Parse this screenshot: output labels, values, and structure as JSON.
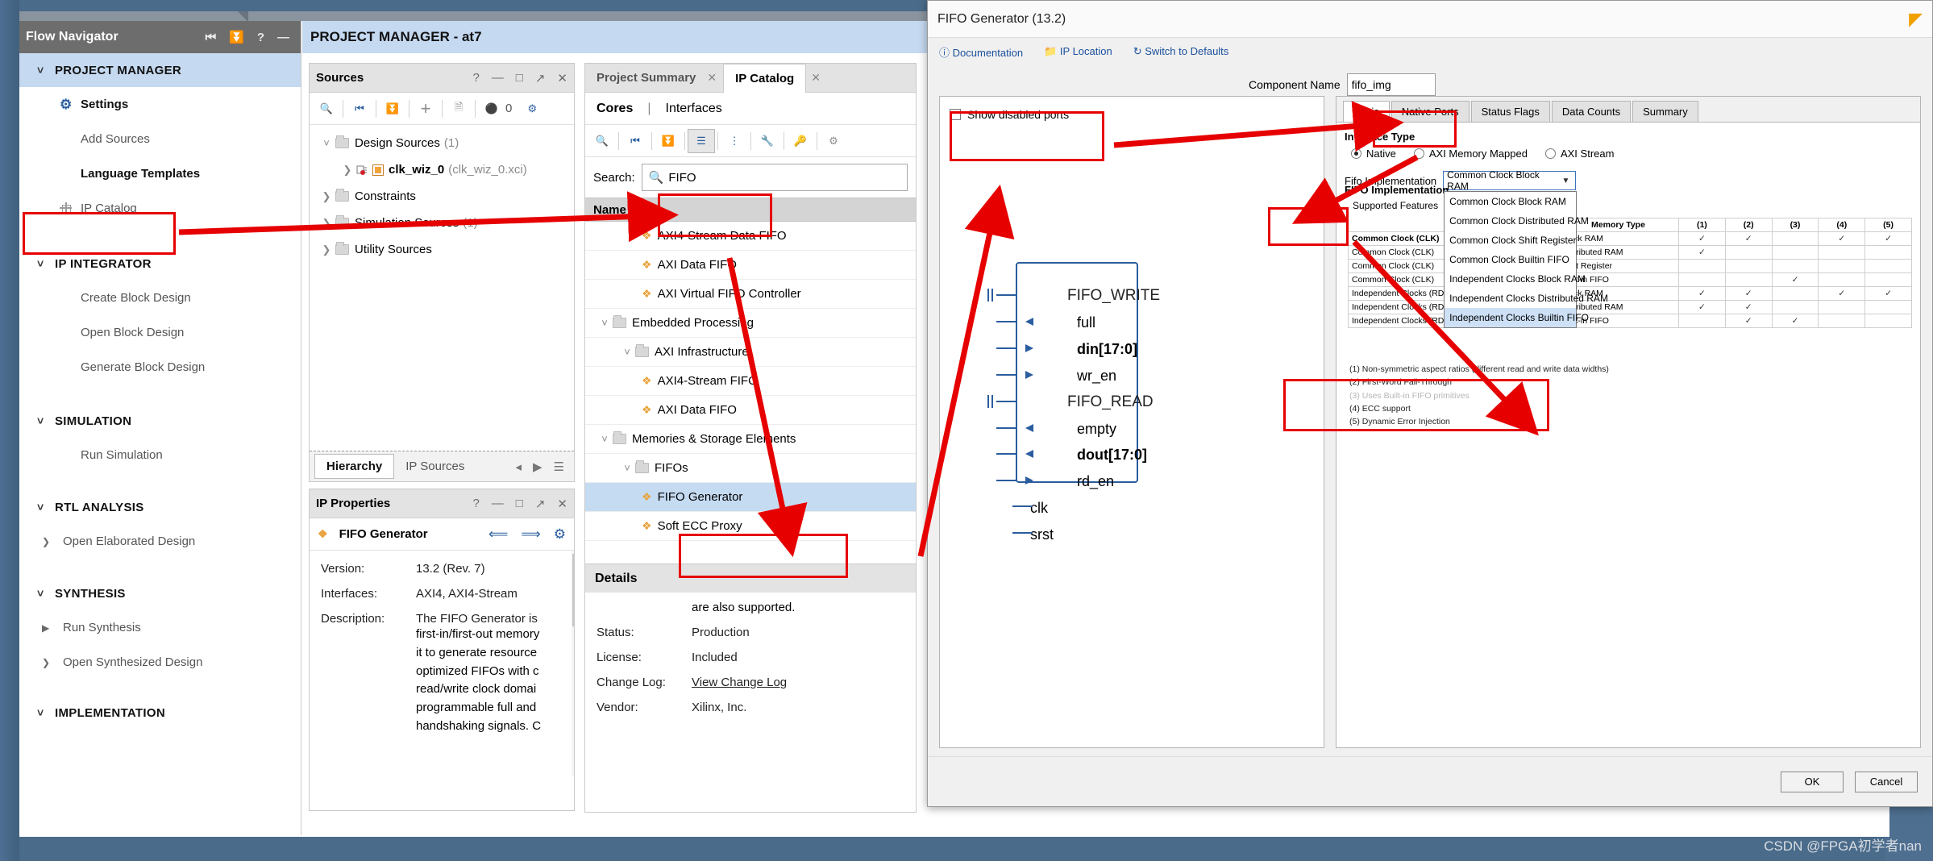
{
  "flow_navigator": {
    "title": "Flow Navigator",
    "header_icons": [
      "collapse-icon",
      "expand-icon",
      "help-icon",
      "minimize-icon"
    ],
    "sections": [
      {
        "label": "PROJECT MANAGER",
        "active": true,
        "items": [
          {
            "label": "Settings",
            "icon": "gear-icon",
            "bold": true
          },
          {
            "label": "Add Sources",
            "icon": "",
            "bold": false
          },
          {
            "label": "Language Templates",
            "icon": "",
            "bold": true
          },
          {
            "label": "IP Catalog",
            "icon": "ip-icon",
            "bold": false,
            "highlighted": true
          }
        ]
      },
      {
        "label": "IP INTEGRATOR",
        "active": false,
        "items": [
          {
            "label": "Create Block Design",
            "icon": "",
            "bold": false
          },
          {
            "label": "Open Block Design",
            "icon": "",
            "bold": false
          },
          {
            "label": "Generate Block Design",
            "icon": "",
            "bold": false
          }
        ]
      },
      {
        "label": "SIMULATION",
        "active": false,
        "items": [
          {
            "label": "Run Simulation",
            "icon": "",
            "bold": false
          }
        ]
      },
      {
        "label": "RTL ANALYSIS",
        "active": false,
        "items": [
          {
            "label": "Open Elaborated Design",
            "icon": "arrow-icon",
            "bold": false
          }
        ]
      },
      {
        "label": "SYNTHESIS",
        "active": false,
        "items": [
          {
            "label": "Run Synthesis",
            "icon": "play-icon",
            "bold": false
          },
          {
            "label": "Open Synthesized Design",
            "icon": "arrow-icon",
            "bold": false
          }
        ]
      },
      {
        "label": "IMPLEMENTATION",
        "active": false,
        "items": []
      }
    ]
  },
  "project_manager": {
    "title": "PROJECT MANAGER - at7"
  },
  "sources_panel": {
    "title": "Sources",
    "window_buttons": [
      "help-icon",
      "minimize-icon",
      "maximize-icon",
      "float-icon",
      "close-icon"
    ],
    "toolbar": [
      "search-icon",
      "collapse-all-icon",
      "expand-all-icon",
      "add-icon",
      "report-icon",
      "warning-icon",
      "gear-icon"
    ],
    "warning_count": "0",
    "tree": [
      {
        "label": "Design Sources",
        "count": "(1)",
        "expanded": true,
        "depth": 0,
        "icon": "folder-icon"
      },
      {
        "label": "clk_wiz_0",
        "sub": "(clk_wiz_0.xci)",
        "expanded": false,
        "depth": 1,
        "icon": "xci-icon"
      },
      {
        "label": "Constraints",
        "count": "",
        "expanded": false,
        "depth": 0,
        "icon": "folder-icon"
      },
      {
        "label": "Simulation Sources",
        "count": "(1)",
        "expanded": false,
        "depth": 0,
        "icon": "folder-icon"
      },
      {
        "label": "Utility Sources",
        "count": "",
        "expanded": false,
        "depth": 0,
        "icon": "folder-icon"
      }
    ],
    "tabs": [
      {
        "label": "Hierarchy",
        "selected": true
      },
      {
        "label": "IP Sources",
        "selected": false
      }
    ]
  },
  "ip_properties": {
    "title": "IP Properties",
    "ip_name": "FIFO Generator",
    "rows": [
      {
        "key": "Version:",
        "value": "13.2 (Rev. 7)",
        "link": false
      },
      {
        "key": "Interfaces:",
        "value": "AXI4, AXI4-Stream",
        "link": false
      },
      {
        "key": "Description:",
        "value": "The FIFO Generator is",
        "link": false
      }
    ],
    "description_lines": [
      "first-in/first-out memory",
      "it to generate resource",
      "optimized FIFOs with c",
      "read/write clock domai",
      "programmable full and",
      "handshaking signals. C"
    ]
  },
  "ip_catalog": {
    "tabs": [
      {
        "label": "Project Summary",
        "selected": false
      },
      {
        "label": "IP Catalog",
        "selected": true
      }
    ],
    "cores_tabs": [
      {
        "label": "Cores",
        "selected": true
      },
      {
        "label": "Interfaces",
        "selected": false
      }
    ],
    "toolbar": [
      "search-icon",
      "collapse-all-icon",
      "expand-all-icon",
      "group-icon",
      "tree-icon",
      "wrench-icon",
      "key-icon",
      "chip-icon"
    ],
    "search_label": "Search:",
    "search_value": "FIFO",
    "column_header": "Name",
    "items": [
      {
        "label": "AXI4-Stream Data FIFO",
        "depth": 2,
        "leaf": true,
        "expanded": false
      },
      {
        "label": "AXI Data FIFO",
        "depth": 2,
        "leaf": true,
        "expanded": false
      },
      {
        "label": "AXI Virtual FIFO Controller",
        "depth": 2,
        "leaf": true,
        "expanded": false
      },
      {
        "label": "Embedded Processing",
        "depth": 0,
        "leaf": false,
        "expanded": true
      },
      {
        "label": "AXI Infrastructure",
        "depth": 1,
        "leaf": false,
        "expanded": true
      },
      {
        "label": "AXI4-Stream FIFO",
        "depth": 2,
        "leaf": true,
        "expanded": false
      },
      {
        "label": "AXI Data FIFO",
        "depth": 2,
        "leaf": true,
        "expanded": false
      },
      {
        "label": "Memories & Storage Elements",
        "depth": 0,
        "leaf": false,
        "expanded": true
      },
      {
        "label": "FIFOs",
        "depth": 1,
        "leaf": false,
        "expanded": true
      },
      {
        "label": "FIFO Generator",
        "depth": 2,
        "leaf": true,
        "expanded": false,
        "selected": true,
        "highlighted": true
      },
      {
        "label": "Soft ECC Proxy",
        "depth": 2,
        "leaf": true,
        "expanded": false
      }
    ],
    "details": {
      "title": "Details",
      "overflow_line": "are also supported.",
      "rows": [
        {
          "key": "Status:",
          "value": "Production",
          "link": true
        },
        {
          "key": "License:",
          "value": "Included",
          "link": false
        },
        {
          "key": "Change Log:",
          "value": "View Change Log",
          "link": true
        },
        {
          "key": "Vendor:",
          "value": "Xilinx, Inc.",
          "link": false
        }
      ]
    }
  },
  "dialog": {
    "title": "FIFO Generator (13.2)",
    "links": [
      {
        "label": "Documentation",
        "icon": "info-icon"
      },
      {
        "label": "IP Location",
        "icon": "folder-icon"
      },
      {
        "label": "Switch to Defaults",
        "icon": "refresh-icon"
      }
    ],
    "show_disabled_ports": {
      "label": "Show disabled ports",
      "checked": false
    },
    "component_name": {
      "label": "Component Name",
      "value": "fifo_img"
    },
    "symbol_ports": [
      {
        "label": "FIFO_WRITE",
        "kind": "bus",
        "dir": "none"
      },
      {
        "label": "full",
        "kind": "out",
        "dir": "left"
      },
      {
        "label": "din[17:0]",
        "kind": "in",
        "dir": "right"
      },
      {
        "label": "wr_en",
        "kind": "in",
        "dir": "right"
      },
      {
        "label": "FIFO_READ",
        "kind": "bus",
        "dir": "none"
      },
      {
        "label": "empty",
        "kind": "out",
        "dir": "left"
      },
      {
        "label": "dout[17:0]",
        "kind": "out",
        "dir": "left"
      },
      {
        "label": "rd_en",
        "kind": "in",
        "dir": "right"
      },
      {
        "label": "clk",
        "kind": "plain",
        "dir": "none"
      },
      {
        "label": "srst",
        "kind": "plain",
        "dir": "none"
      }
    ],
    "tabs": [
      {
        "label": "Basic",
        "selected": true
      },
      {
        "label": "Native Ports",
        "selected": false
      },
      {
        "label": "Status Flags",
        "selected": false
      },
      {
        "label": "Data Counts",
        "selected": false
      },
      {
        "label": "Summary",
        "selected": false
      }
    ],
    "interface_type": {
      "label": "Interface Type",
      "options": [
        {
          "label": "Native",
          "selected": true
        },
        {
          "label": "AXI Memory Mapped",
          "selected": false
        },
        {
          "label": "AXI Stream",
          "selected": false
        }
      ]
    },
    "fifo_implementation": {
      "label": "Fifo Implementation",
      "value": "Common Clock Block RAM",
      "open": true,
      "options": [
        "Common Clock Block RAM",
        "Common Clock Distributed RAM",
        "Common Clock Shift Register",
        "Common Clock Builtin FIFO",
        "Independent Clocks Block RAM",
        "Independent Clocks Distributed RAM",
        "Independent Clocks Builtin FIFO"
      ],
      "highlighted_option": "Independent Clocks Builtin FIFO"
    },
    "feature_table": {
      "section_label": "FIFO Implementation",
      "sub_label": "Supported Features",
      "col_group": "Memory Type",
      "columns": [
        "(1)",
        "(2)",
        "(3)",
        "(4)",
        "(5)"
      ],
      "groups": [
        {
          "name": "Common Clock (CLK)",
          "rows": [
            {
              "type": "Block RAM",
              "marks": [
                "check",
                "check",
                "",
                "check",
                "check"
              ]
            },
            {
              "type": "Distributed RAM",
              "marks": [
                "check",
                "",
                "",
                "",
                ""
              ]
            },
            {
              "type": "Shift Register",
              "marks": [
                "",
                "",
                "",
                "",
                ""
              ]
            },
            {
              "type": "Built-in FIFO",
              "marks": [
                "",
                "",
                "check",
                "",
                ""
              ]
            }
          ]
        },
        {
          "name": "Independent Clocks (RD_CLK, WR_CLK)",
          "rows": [
            {
              "type": "Block RAM",
              "marks": [
                "check",
                "check",
                "",
                "check",
                "check"
              ]
            },
            {
              "type": "Distributed RAM",
              "marks": [
                "check",
                "check",
                "",
                "",
                ""
              ]
            },
            {
              "type": "Built-in FIFO",
              "marks": [
                "",
                "check",
                "check",
                "",
                ""
              ]
            }
          ]
        }
      ],
      "notes": [
        {
          "text": "(1) Non-symmetric aspect ratios (different read and write data widths)",
          "disabled": false
        },
        {
          "text": "(2) First-Word Fall-Through",
          "disabled": false
        },
        {
          "text": "(3) Uses Built-in FIFO primitives",
          "disabled": true
        },
        {
          "text": "(4) ECC support",
          "disabled": false
        },
        {
          "text": "(5) Dynamic Error Injection",
          "disabled": false
        }
      ]
    },
    "buttons": [
      {
        "label": "OK"
      },
      {
        "label": "Cancel"
      }
    ]
  },
  "watermark": "CSDN @FPGA初学者nan",
  "colors": {
    "accent": "#e60000",
    "highlight": "#c5d9f1",
    "link": "#1a4f9c"
  }
}
